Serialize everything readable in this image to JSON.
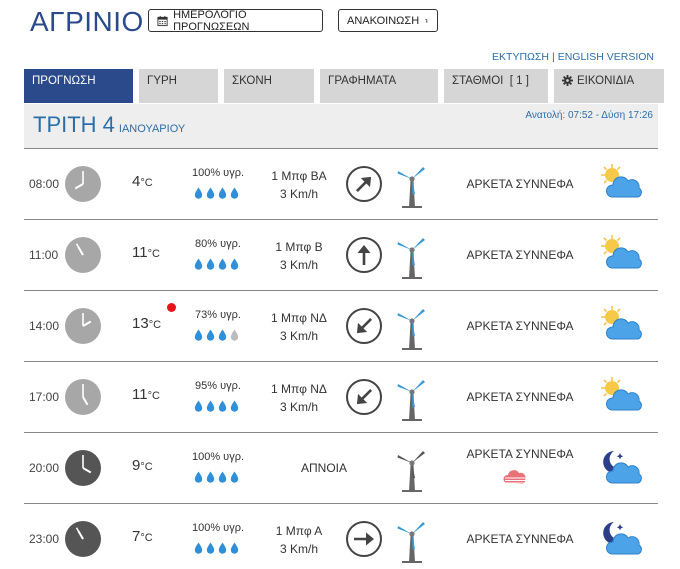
{
  "city": "ΑΓΡΙΝΙΟ",
  "buttons": {
    "calendar_label": "ΗΜΕΡΟΛΟΓΙΟ ΠΡΟΓΝΩΣΕΩΝ",
    "announce_label": "ΑΝΑΚΟΙΝΩΣΗ"
  },
  "links": {
    "print": "ΕΚΤΥΠΩΣΗ",
    "separator": "|",
    "english": "ENGLISH VERSION"
  },
  "tabs": [
    "ΠΡΟΓΝΩΣΗ",
    "ΓΥΡΗ",
    "ΣΚΟΝΗ",
    "ΓΡΑΦΗΜΑΤΑ",
    "ΣΤΑΘΜΟΙ  [ 1 ]",
    "ΕΙΚΟΝΙΔΙΑ"
  ],
  "day": {
    "name": "ΤΡΙΤΗ 4",
    "month": "ΙΑΝΟΥΑΡΙΟΥ",
    "sun": "Ανατολή: 07:52  - Δύση 17:26"
  },
  "unit": "°C",
  "rows": [
    {
      "time": "08:00",
      "temp": "4",
      "humidity": "100% υγρ.",
      "drops": 4,
      "wind_force": "1 Μπφ ΒΑ",
      "wind_speed": "3 Km/h",
      "condition": "ΑΡΚΕΤΑ ΣΥΝΝΕΦΑ",
      "night": false
    },
    {
      "time": "11:00",
      "temp": "11",
      "humidity": "80% υγρ.",
      "drops": 4,
      "wind_force": "1 Μπφ Β",
      "wind_speed": "3 Km/h",
      "condition": "ΑΡΚΕΤΑ ΣΥΝΝΕΦΑ",
      "night": false
    },
    {
      "time": "14:00",
      "temp": "13",
      "humidity": "73% υγρ.",
      "drops": 3,
      "wind_force": "1 Μπφ ΝΔ",
      "wind_speed": "3 Km/h",
      "condition": "ΑΡΚΕΤΑ ΣΥΝΝΕΦΑ",
      "night": false,
      "hot": true
    },
    {
      "time": "17:00",
      "temp": "11",
      "humidity": "95% υγρ.",
      "drops": 4,
      "wind_force": "1 Μπφ ΝΔ",
      "wind_speed": "3 Km/h",
      "condition": "ΑΡΚΕΤΑ ΣΥΝΝΕΦΑ",
      "night": false
    },
    {
      "time": "20:00",
      "temp": "9",
      "humidity": "100% υγρ.",
      "drops": 4,
      "calm": "ΑΠΝΟΙΑ",
      "condition": "ΑΡΚΕΤΑ ΣΥΝΝΕΦΑ",
      "night": true,
      "fog": true
    },
    {
      "time": "23:00",
      "temp": "7",
      "humidity": "100% υγρ.",
      "drops": 4,
      "wind_force": "1 Μπφ Α",
      "wind_speed": "3 Km/h",
      "condition": "ΑΡΚΕΤΑ ΣΥΝΝΕΦΑ",
      "night": true
    }
  ],
  "colors": {
    "brand": "#2b4a8c",
    "link": "#2b6ea8",
    "drop": "#2f8fd8",
    "hot_dot": "#e8141a"
  },
  "icons": {
    "calendar": "calendar-icon",
    "announce": "turn-arrow-icon",
    "icons_tab": "gear-icon"
  }
}
